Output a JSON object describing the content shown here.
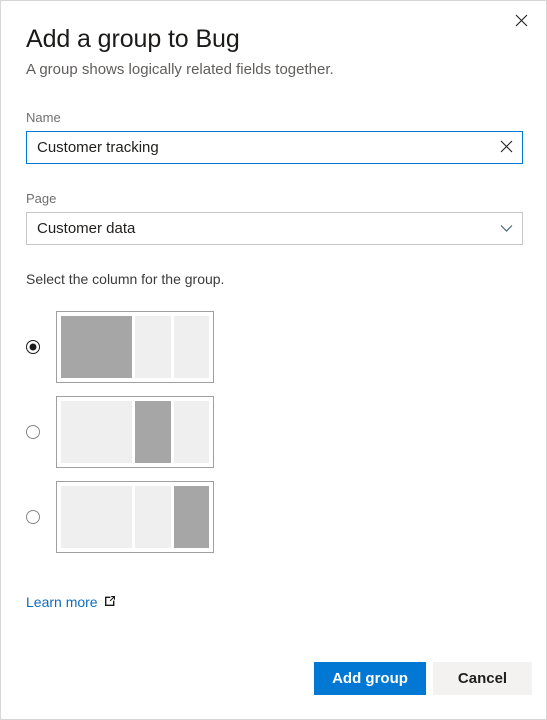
{
  "dialog": {
    "title": "Add a group to Bug",
    "subtitle": "A group shows logically related fields together.",
    "close_label": "Close"
  },
  "name_field": {
    "label": "Name",
    "value": "Customer tracking",
    "placeholder": "Enter a name",
    "clear_label": "Clear"
  },
  "page_field": {
    "label": "Page",
    "value": "Customer data",
    "options": [
      "Customer data"
    ]
  },
  "column_selector": {
    "label": "Select the column for the group.",
    "selected_index": 0,
    "options": [
      {
        "name": "first-column",
        "selected": true,
        "panes": [
          "active",
          "idle",
          "idle"
        ]
      },
      {
        "name": "second-column",
        "selected": false,
        "panes": [
          "idle",
          "active",
          "idle"
        ]
      },
      {
        "name": "third-column",
        "selected": false,
        "panes": [
          "idle",
          "idle",
          "active"
        ]
      }
    ]
  },
  "learn_more": {
    "label": "Learn more",
    "icon": "external-link-icon"
  },
  "footer": {
    "primary_label": "Add group",
    "secondary_label": "Cancel"
  },
  "colors": {
    "accent": "#0078d4",
    "link": "#0f6cbd",
    "pane_active": "#a6a6a6",
    "pane_idle": "#efefef",
    "secondary_button": "#f3f2f1"
  }
}
